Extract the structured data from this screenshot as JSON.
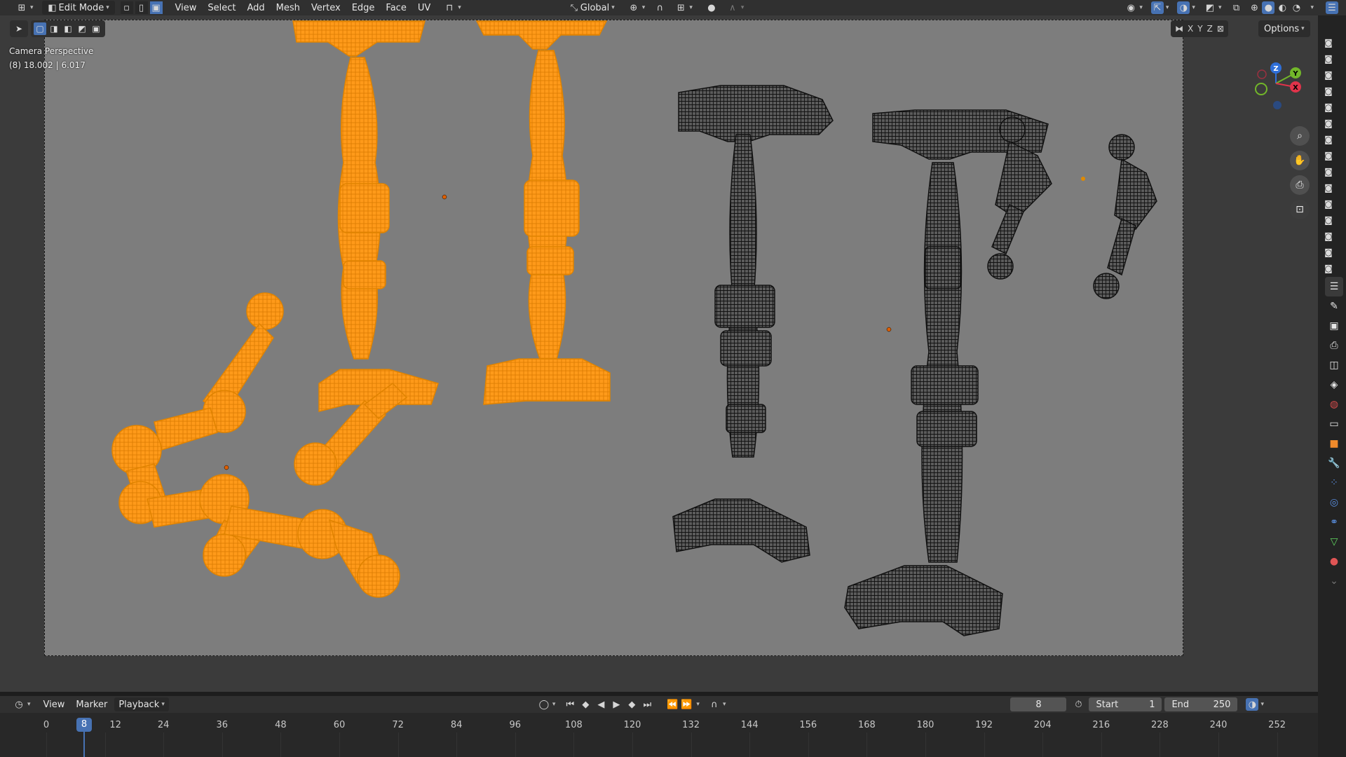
{
  "header": {
    "mode": "Edit Mode",
    "menus": [
      "View",
      "Select",
      "Add",
      "Mesh",
      "Vertex",
      "Edge",
      "Face",
      "UV"
    ],
    "transform_orientation": "Global"
  },
  "viewport": {
    "camera_label": "Camera Perspective",
    "object_info": "(8) 18.002 | 6.017",
    "axes": [
      "X",
      "Y",
      "Z"
    ],
    "options_label": "Options",
    "gizmo": {
      "x": "X",
      "y": "Y",
      "z": "Z"
    }
  },
  "timeline": {
    "menus": [
      "View",
      "Marker",
      "Playback"
    ],
    "current_frame": "8",
    "start_label": "Start",
    "start_value": "1",
    "end_label": "End",
    "end_value": "250",
    "ticks": [
      "0",
      "12",
      "24",
      "36",
      "48",
      "60",
      "72",
      "84",
      "96",
      "108",
      "120",
      "132",
      "144",
      "156",
      "168",
      "180",
      "192",
      "204",
      "216",
      "228",
      "240",
      "252"
    ]
  },
  "colors": {
    "selected": "#ff9a1a",
    "wire": "#1a1a1a",
    "accent": "#4772b3"
  }
}
